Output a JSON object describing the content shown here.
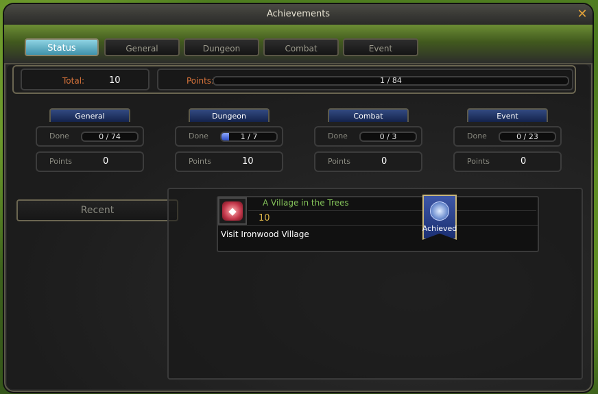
{
  "window": {
    "title": "Achievements"
  },
  "tabs": [
    {
      "label": "Status",
      "active": true
    },
    {
      "label": "General",
      "active": false
    },
    {
      "label": "Dungeon",
      "active": false
    },
    {
      "label": "Combat",
      "active": false
    },
    {
      "label": "Event",
      "active": false
    }
  ],
  "summary": {
    "total_label": "Total:",
    "total_value": "10",
    "points_label": "Points:",
    "points_value": "1 / 84",
    "points_progress": 0.012
  },
  "categories": [
    {
      "name": "General",
      "done_label": "Done",
      "done": "0 / 74",
      "done_progress": 0.0,
      "points_label": "Points",
      "points": "0"
    },
    {
      "name": "Dungeon",
      "done_label": "Done",
      "done": "1 / 7",
      "done_progress": 0.143,
      "points_label": "Points",
      "points": "10"
    },
    {
      "name": "Combat",
      "done_label": "Done",
      "done": "0 / 3",
      "done_progress": 0.0,
      "points_label": "Points",
      "points": "0"
    },
    {
      "name": "Event",
      "done_label": "Done",
      "done": "0 / 23",
      "done_progress": 0.0,
      "points_label": "Points",
      "points": "0"
    }
  ],
  "recent": {
    "button_label": "Recent",
    "items": [
      {
        "title": "A Village in the Trees",
        "points": "10",
        "description": "Visit Ironwood Village",
        "status": "Achieved",
        "icon": "dungeon-gem-icon"
      }
    ]
  },
  "colors": {
    "accent_orange": "#d9743a",
    "achievement_green": "#84c35a",
    "points_gold": "#e0b84a",
    "tab_active": "#5fb3ca"
  }
}
